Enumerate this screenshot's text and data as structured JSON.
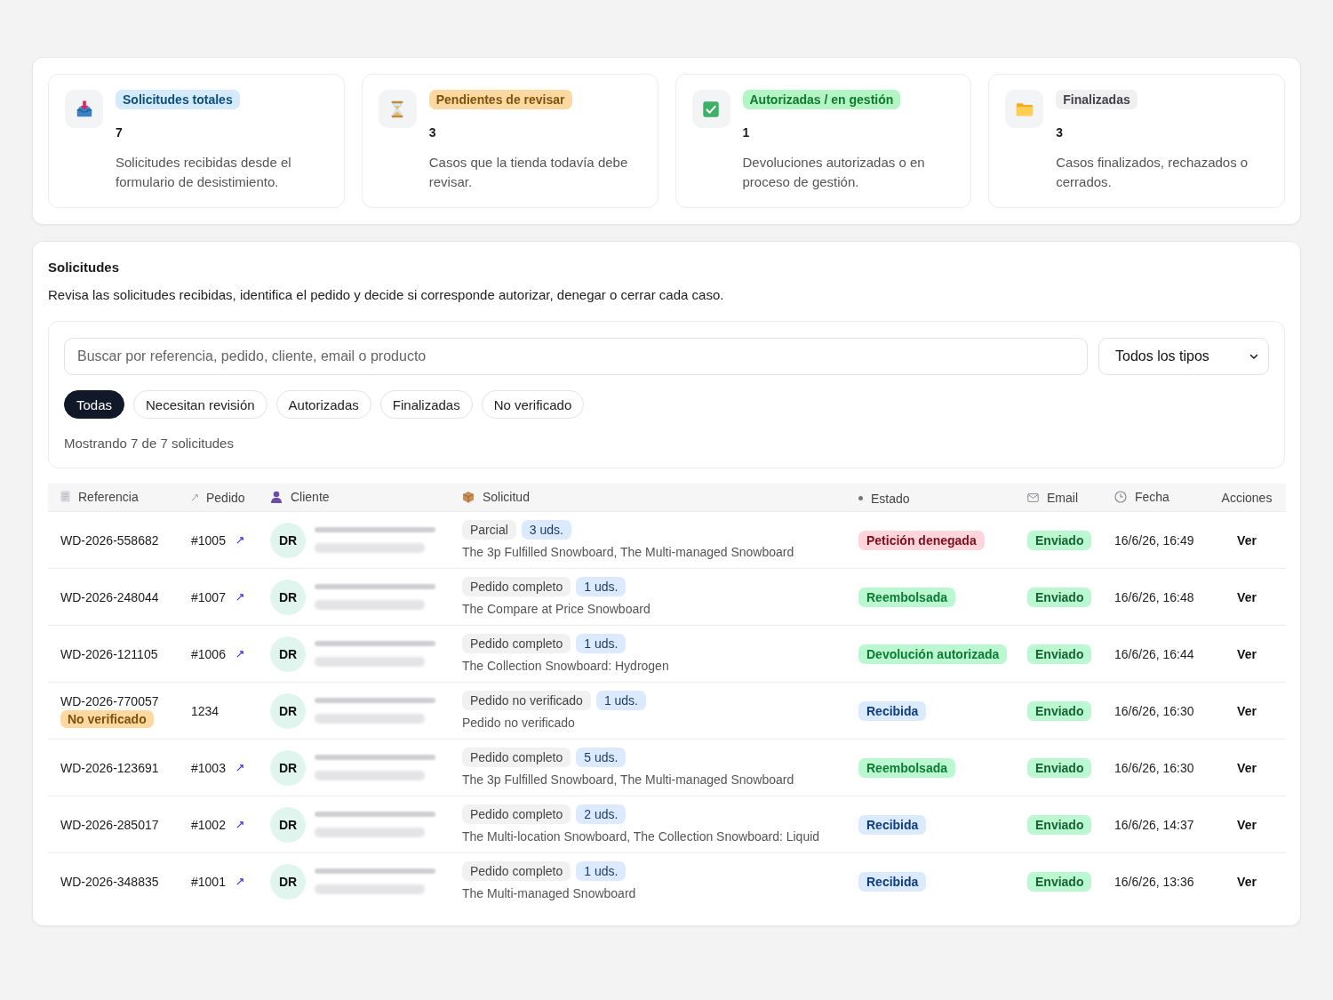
{
  "summary_cards": [
    {
      "badge": {
        "label": "Solicitudes totales",
        "color": "#d5ebfb"
      },
      "value": "7",
      "description": "Solicitudes recibidas desde el formulario de desistimiento."
    },
    {
      "badge": {
        "label": "Pendientes de revisar",
        "color": "#fdd9a1"
      },
      "value": "3",
      "description": "Casos que la tienda todavía debe revisar."
    },
    {
      "badge": {
        "label": "Autorizadas / en gestión",
        "color": "#b4f5c6"
      },
      "value": "1",
      "description": "Devoluciones autorizadas o en proceso de gestión."
    },
    {
      "badge": {
        "label": "Finalizadas",
        "color": "#f0f0f1"
      },
      "value": "3",
      "description": "Casos finalizados, rechazados o cerrados."
    }
  ],
  "requests_panel": {
    "title": "Solicitudes",
    "description": "Revisa las solicitudes recibidas, identifica el pedido y decide si corresponde autorizar, denegar o cerrar cada caso.",
    "search": {
      "placeholder": "Buscar por referencia, pedido, cliente, email o producto"
    },
    "type_filter": {
      "value": "Todos los tipos"
    },
    "filter_chips": [
      {
        "label": "Todas",
        "selected": true
      },
      {
        "label": "Necesitan revisión",
        "selected": false
      },
      {
        "label": "Autorizadas",
        "selected": false
      },
      {
        "label": "Finalizadas",
        "selected": false
      },
      {
        "label": "No verificado",
        "selected": false
      }
    ],
    "result_count": "Mostrando 7 de 7 solicitudes",
    "table": {
      "columns": [
        "Referencia",
        "Pedido",
        "Cliente",
        "Solicitud",
        "Estado",
        "Email",
        "Fecha",
        "Acciones"
      ],
      "rows": [
        {
          "reference": "WD-2026-558682",
          "order": "#1005",
          "order_linked": true,
          "initials": "DR",
          "request": {
            "tags": [
              {
                "kind": "type",
                "label": "Parcial"
              },
              {
                "kind": "quantity",
                "label": "3 uds."
              }
            ],
            "products": "The 3p Fulfilled Snowboard, The Multi-managed Snowboard"
          },
          "status": {
            "label": "Petición denegada",
            "color": "#fdd5db"
          },
          "email_status": "Enviado",
          "date": "16/6/26, 16:49",
          "action": "Ver"
        },
        {
          "reference": "WD-2026-248044",
          "order": "#1007",
          "order_linked": true,
          "initials": "DR",
          "request": {
            "tags": [
              {
                "kind": "type",
                "label": "Pedido completo"
              },
              {
                "kind": "quantity",
                "label": "1 uds."
              }
            ],
            "products": "The Compare at Price Snowboard"
          },
          "status": {
            "label": "Reembolsada",
            "color": "#bbf7d0"
          },
          "email_status": "Enviado",
          "date": "16/6/26, 16:48",
          "action": "Ver"
        },
        {
          "reference": "WD-2026-121105",
          "order": "#1006",
          "order_linked": true,
          "initials": "DR",
          "request": {
            "tags": [
              {
                "kind": "type",
                "label": "Pedido completo"
              },
              {
                "kind": "quantity",
                "label": "1 uds."
              }
            ],
            "products": "The Collection Snowboard: Hydrogen"
          },
          "status": {
            "label": "Devolución autorizada",
            "color": "#bbf7d0"
          },
          "email_status": "Enviado",
          "date": "16/6/26, 16:44",
          "action": "Ver"
        },
        {
          "reference": "WD-2026-770057",
          "reference_tag": {
            "label": "No verificado",
            "color": "#fdd9a1"
          },
          "order": "1234",
          "order_linked": false,
          "initials": "DR",
          "request": {
            "tags": [
              {
                "kind": "type",
                "label": "Pedido no verificado"
              },
              {
                "kind": "quantity",
                "label": "1 uds."
              }
            ],
            "products": "Pedido no verificado"
          },
          "status": {
            "label": "Recibida",
            "color": "#dbeafe"
          },
          "email_status": "Enviado",
          "date": "16/6/26, 16:30",
          "action": "Ver"
        },
        {
          "reference": "WD-2026-123691",
          "order": "#1003",
          "order_linked": true,
          "initials": "DR",
          "request": {
            "tags": [
              {
                "kind": "type",
                "label": "Pedido completo"
              },
              {
                "kind": "quantity",
                "label": "5 uds."
              }
            ],
            "products": "The 3p Fulfilled Snowboard, The Multi-managed Snowboard"
          },
          "status": {
            "label": "Reembolsada",
            "color": "#bbf7d0"
          },
          "email_status": "Enviado",
          "date": "16/6/26, 16:30",
          "action": "Ver"
        },
        {
          "reference": "WD-2026-285017",
          "order": "#1002",
          "order_linked": true,
          "initials": "DR",
          "request": {
            "tags": [
              {
                "kind": "type",
                "label": "Pedido completo"
              },
              {
                "kind": "quantity",
                "label": "2 uds."
              }
            ],
            "products": "The Multi-location Snowboard, The Collection Snowboard: Liquid"
          },
          "status": {
            "label": "Recibida",
            "color": "#dbeafe"
          },
          "email_status": "Enviado",
          "date": "16/6/26, 14:37",
          "action": "Ver"
        },
        {
          "reference": "WD-2026-348835",
          "order": "#1001",
          "order_linked": true,
          "initials": "DR",
          "request": {
            "tags": [
              {
                "kind": "type",
                "label": "Pedido completo"
              },
              {
                "kind": "quantity",
                "label": "1 uds."
              }
            ],
            "products": "The Multi-managed Snowboard"
          },
          "status": {
            "label": "Recibida",
            "color": "#dbeafe"
          },
          "email_status": "Enviado",
          "date": "16/6/26, 13:36",
          "action": "Ver"
        }
      ]
    }
  }
}
